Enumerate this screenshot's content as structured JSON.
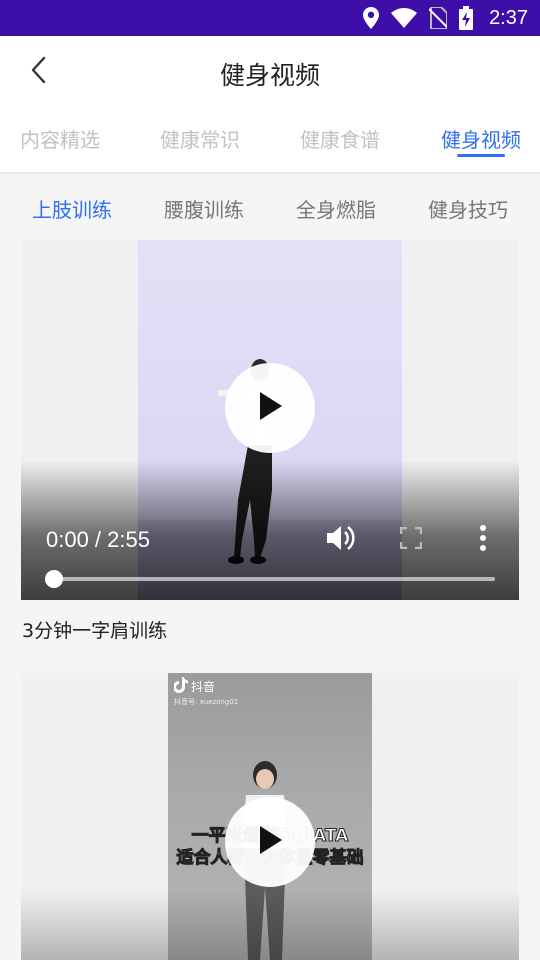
{
  "status_bar": {
    "time": "2:37",
    "icons": [
      "location-icon",
      "wifi-icon",
      "no-sim-icon",
      "battery-charging-icon"
    ]
  },
  "header": {
    "title": "健身视频",
    "back_icon": "chevron-left-icon"
  },
  "main_tabs": [
    {
      "label": "内容精选",
      "active": false
    },
    {
      "label": "健康常识",
      "active": false
    },
    {
      "label": "健康食谱",
      "active": false
    },
    {
      "label": "健身视频",
      "active": true
    }
  ],
  "sub_tabs": [
    {
      "label": "上肢训练",
      "active": true
    },
    {
      "label": "腰腹训练",
      "active": false
    },
    {
      "label": "全身燃脂",
      "active": false
    },
    {
      "label": "健身技巧",
      "active": false
    }
  ],
  "videos": [
    {
      "time_display": "0:00 / 2:55",
      "progress": 0,
      "caption": "3分钟一字肩训练"
    },
    {
      "watermark_app": "抖音",
      "watermark_id": "抖音号: xuezong01",
      "banner_line1": "一平米燃脂TABATA",
      "banner_line2": "适合人群：大体重零基础"
    }
  ],
  "colors": {
    "status_bar": "#3d0fa8",
    "accent": "#2f6ff0",
    "inactive_tab": "#c2c2c2"
  }
}
